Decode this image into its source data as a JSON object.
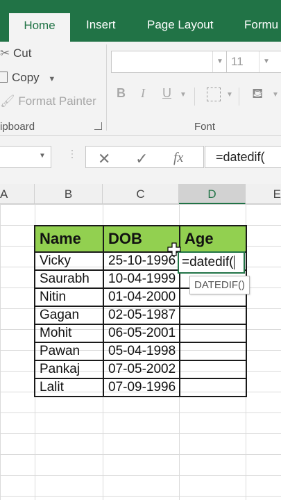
{
  "ribbon_tabs": [
    "Home",
    "Insert",
    "Page Layout",
    "Formu"
  ],
  "clipboard": {
    "cut_label": "Cut",
    "copy_label": "Copy",
    "format_painter_label": "Format Painter",
    "group_label": "ipboard"
  },
  "font": {
    "name_value": "",
    "size_value": "11",
    "bold": "B",
    "italic": "I",
    "underline": "U",
    "group_label": "Font"
  },
  "formula_bar": {
    "name_box_value": "",
    "cancel_glyph": "✕",
    "enter_glyph": "✓",
    "fx_label": "fx",
    "formula_value": "=datedif("
  },
  "columns": [
    "A",
    "B",
    "C",
    "D",
    "E"
  ],
  "selected_column": "D",
  "table": {
    "headers": [
      "Name",
      "DOB",
      "Age"
    ],
    "rows": [
      [
        "Vicky",
        "25-10-1996"
      ],
      [
        "Saurabh",
        "10-04-1999"
      ],
      [
        "Nitin",
        "01-04-2000"
      ],
      [
        "Gagan",
        "02-05-1987"
      ],
      [
        "Mohit",
        "06-05-2001"
      ],
      [
        "Pawan",
        "05-04-1998"
      ],
      [
        "Pankaj",
        "07-05-2002"
      ],
      [
        "Lalit",
        "07-09-1996"
      ]
    ],
    "header_fill": "#92d050"
  },
  "active_cell_text": "=datedif(",
  "autocomplete_tip": "DATEDIF()",
  "colors": {
    "accent": "#217346"
  }
}
